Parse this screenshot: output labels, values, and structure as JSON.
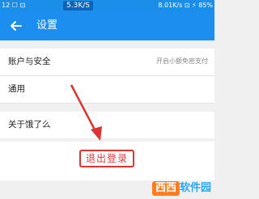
{
  "statusbar": {
    "left": "12 ☐ ⊡",
    "speed_badge": "5.3K/S",
    "right": "8.01K/s  ⊡  ⚡  85%"
  },
  "appbar": {
    "title": "设置"
  },
  "settings": {
    "items": [
      {
        "label": "账户与安全",
        "value": "开启小额免密支付"
      },
      {
        "label": "通用",
        "value": ""
      },
      {
        "label": "关于饿了么",
        "value": ""
      }
    ]
  },
  "logout": {
    "label": "退出登录"
  },
  "watermark": {
    "badge": "西西",
    "text": "软件园"
  },
  "colors": {
    "primary": "#1b8ef0",
    "logout_text": "#e0383d",
    "annotation": "#d93535"
  }
}
